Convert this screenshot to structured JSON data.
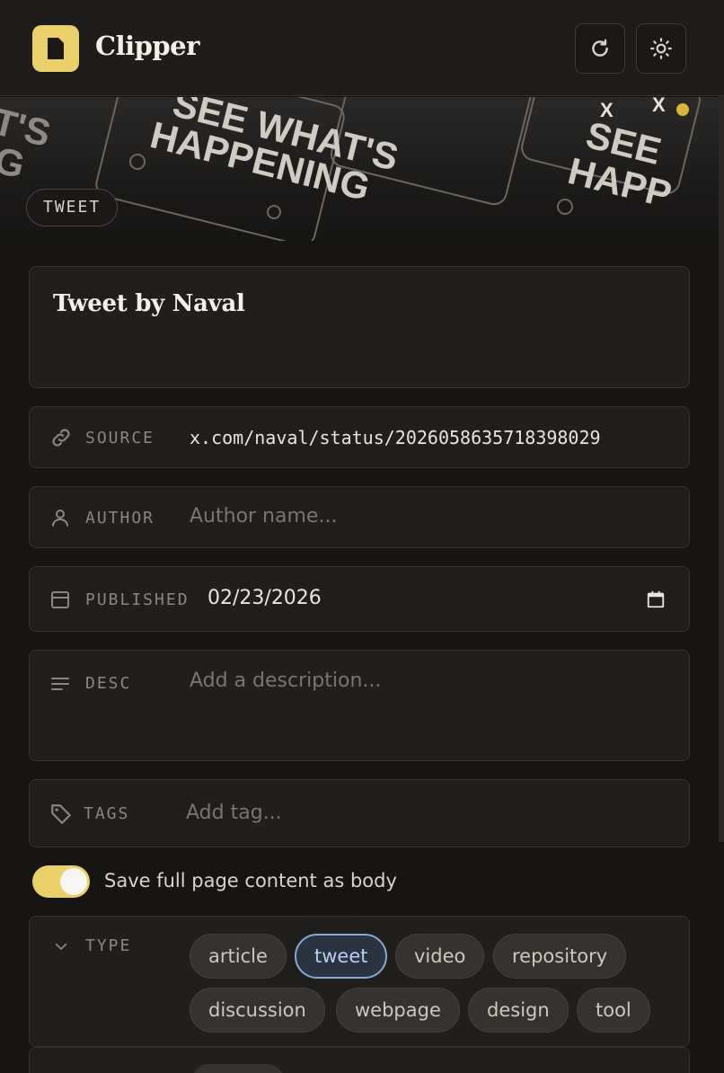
{
  "app": {
    "title": "Clipper"
  },
  "banner": {
    "type_badge": "TWEET"
  },
  "note": {
    "title": "Tweet by Naval"
  },
  "fields": {
    "source": {
      "label": "SOURCE",
      "value": "x.com/naval/status/2026058635718398029"
    },
    "author": {
      "label": "AUTHOR",
      "placeholder": "Author name..."
    },
    "published": {
      "label": "PUBLISHED",
      "value": "02/23/2026"
    },
    "desc": {
      "label": "DESC",
      "placeholder": "Add a description..."
    },
    "tags": {
      "label": "TAGS",
      "placeholder": "Add tag..."
    }
  },
  "toggle": {
    "label": "Save full page content as body",
    "on": true
  },
  "type_section": {
    "label": "TYPE",
    "options": [
      {
        "label": "article",
        "active": false
      },
      {
        "label": "tweet",
        "active": true
      },
      {
        "label": "video",
        "active": false
      },
      {
        "label": "repository",
        "active": false
      },
      {
        "label": "discussion",
        "active": false
      },
      {
        "label": "webpage",
        "active": false
      },
      {
        "label": "design",
        "active": false
      },
      {
        "label": "tool",
        "active": false
      }
    ]
  },
  "colors": {
    "accent": "#ead06b",
    "active_chip": "#86a8d8",
    "background": "#161514"
  },
  "icons": [
    "note-icon",
    "refresh-icon",
    "sun-icon",
    "link-icon",
    "user-icon",
    "calendar-icon",
    "lines-icon",
    "tag-icon",
    "chevron-down-icon"
  ]
}
